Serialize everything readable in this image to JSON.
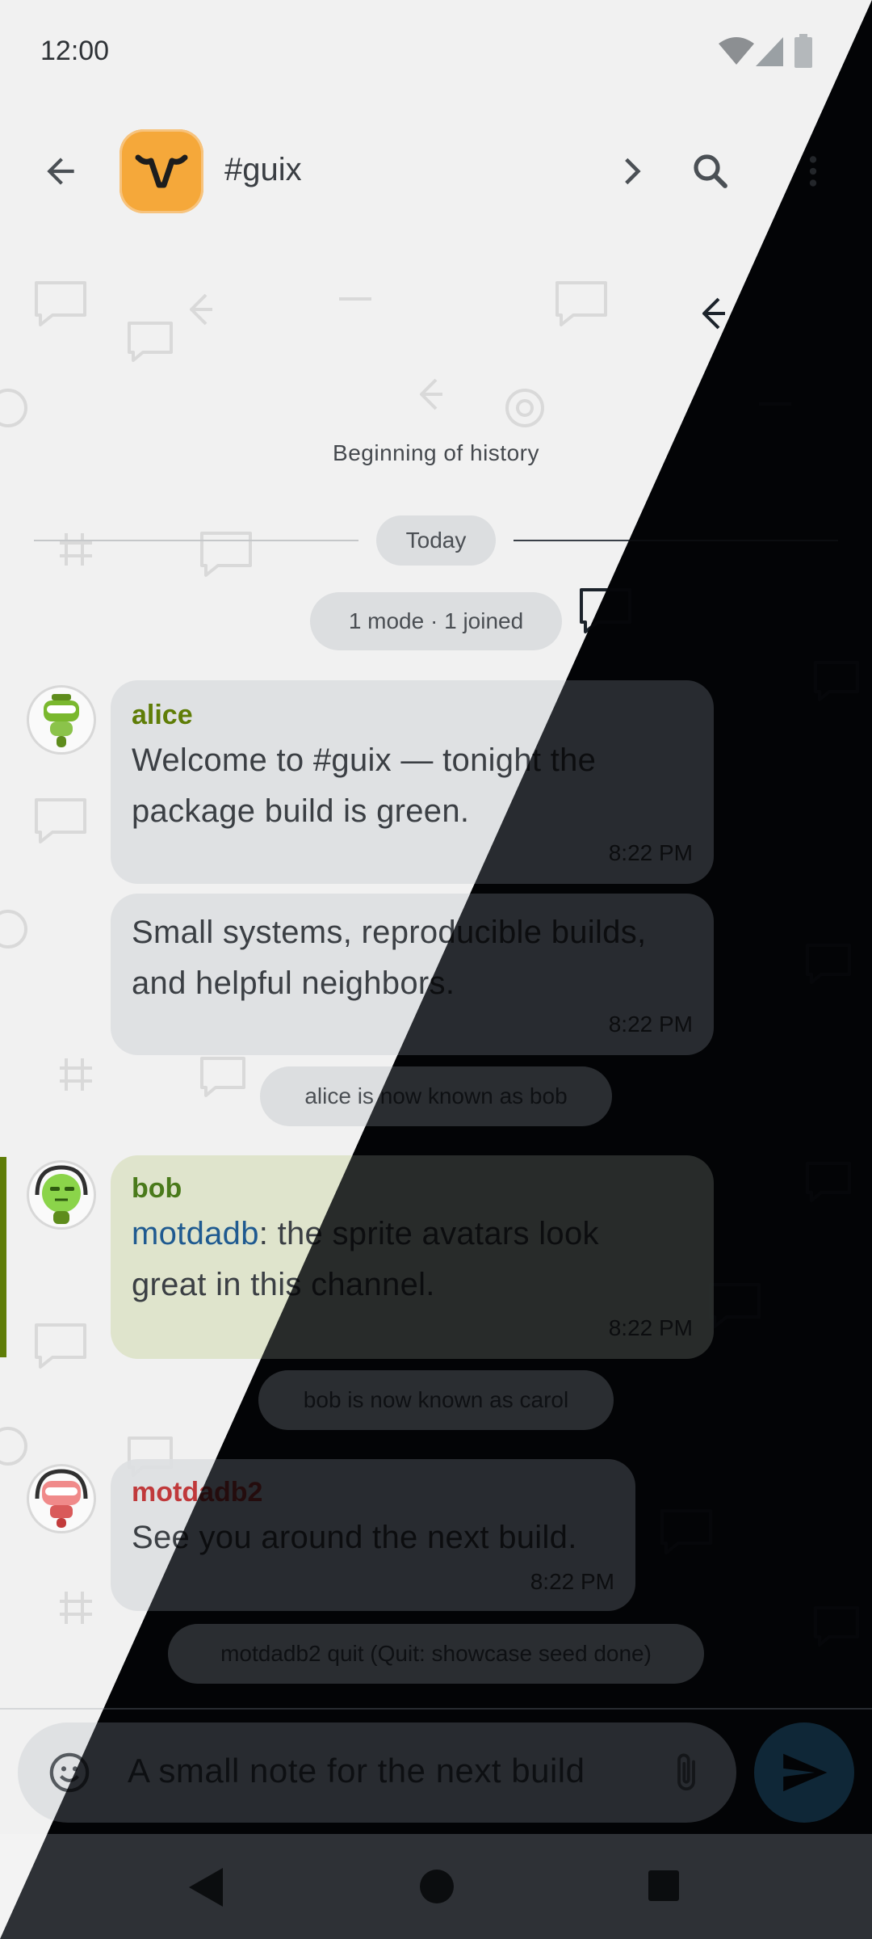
{
  "status_bar": {
    "time": "12:00"
  },
  "app_bar": {
    "channel_name": "#guix"
  },
  "chat": {
    "beginning_label": "Beginning of history",
    "date_divider": "Today",
    "events": {
      "mode_joined": "1 mode · 1 joined",
      "rename_alice": "alice is now known as bob",
      "rename_bob": "bob is now known as carol",
      "quit": "motdadb2 quit (Quit: showcase seed done)"
    },
    "messages": [
      {
        "nick": "alice",
        "text": "Welcome to #guix — tonight the package build is green.",
        "time": "8:22 PM",
        "nick_color": "#5f7d07"
      },
      {
        "text": "Small systems, reproducible builds, and helpful neighbors.",
        "time": "8:22 PM"
      },
      {
        "nick": "bob",
        "mention": "motdadb",
        "text": ": the sprite avatars look great in this channel.",
        "time": "8:22 PM",
        "nick_color": "#4a7a1b",
        "mention_color": "#1f5a90"
      },
      {
        "nick": "motdadb2",
        "text": "See you around the next build.",
        "time": "8:22 PM",
        "nick_color": "#c0393b"
      }
    ]
  },
  "composer": {
    "value": "A small note for the next build"
  },
  "colors": {
    "accent": "#4fc3f7",
    "channel_avatar": "#f5a83a",
    "highlight_bar": "#5f7d07",
    "highlight_bubble": "#dde3c9",
    "dark_overlay": "#0e1217"
  },
  "icons": {
    "back": "arrow-left-icon",
    "forward": "chevron-right-icon",
    "search": "search-icon",
    "more": "more-vert-icon",
    "emoji": "emoji-icon",
    "attach": "paperclip-icon",
    "send": "send-icon",
    "wifi": "wifi-icon",
    "signal": "signal-icon",
    "battery": "battery-icon"
  }
}
